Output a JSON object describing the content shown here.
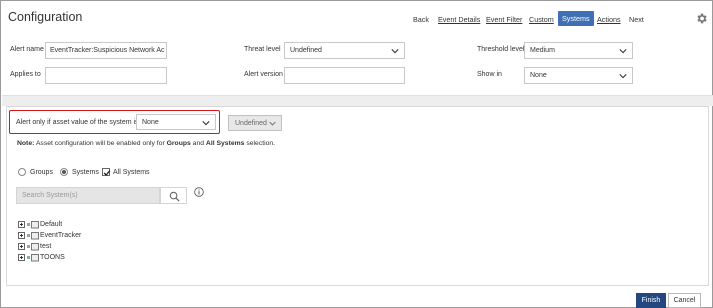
{
  "header": {
    "title": "Configuration",
    "nav": [
      {
        "label": "Back",
        "style": "plain"
      },
      {
        "label": "Event Details",
        "style": "link"
      },
      {
        "label": "Event Filter",
        "style": "link"
      },
      {
        "label": "Custom",
        "style": "link"
      },
      {
        "label": "Systems",
        "style": "active"
      },
      {
        "label": "Actions",
        "style": "link"
      },
      {
        "label": "Next",
        "style": "plain"
      }
    ],
    "settings_icon": "gear-icon"
  },
  "form": {
    "alert_name_label": "Alert name",
    "alert_name_value": "EventTracker:Suspicious Network Ac",
    "threat_level_label": "Threat level",
    "threat_level_value": "Undefined",
    "threshold_level_label": "Threshold level",
    "threshold_level_value": "Medium",
    "applies_to_label": "Applies to",
    "applies_to_value": "",
    "alert_version_label": "Alert version",
    "alert_version_value": "",
    "show_in_label": "Show in",
    "show_in_value": "None"
  },
  "systems": {
    "asset_label": "Alert only if asset value of the system is",
    "asset_value": "None",
    "undefined_button": "Undefined",
    "note_prefix": "Note:",
    "note_text": " Asset configuration will be enabled only for ",
    "note_groups": "Groups",
    "note_and": " and ",
    "note_all_systems": "All Systems",
    "note_suffix": " selection.",
    "radio_groups": "Groups",
    "radio_systems": "Systems",
    "radio_selected": "Systems",
    "check_all_systems": "All Systems",
    "all_systems_checked": true,
    "search_placeholder": "Search System(s)",
    "tree": [
      "Default",
      "EventTracker",
      "test",
      "TOONS"
    ]
  },
  "footer": {
    "finish": "Finish",
    "cancel": "Cancel"
  },
  "colors": {
    "active_tab": "#3f6fb5",
    "highlight_box": "#d11a1a",
    "finish_button": "#24477f"
  }
}
